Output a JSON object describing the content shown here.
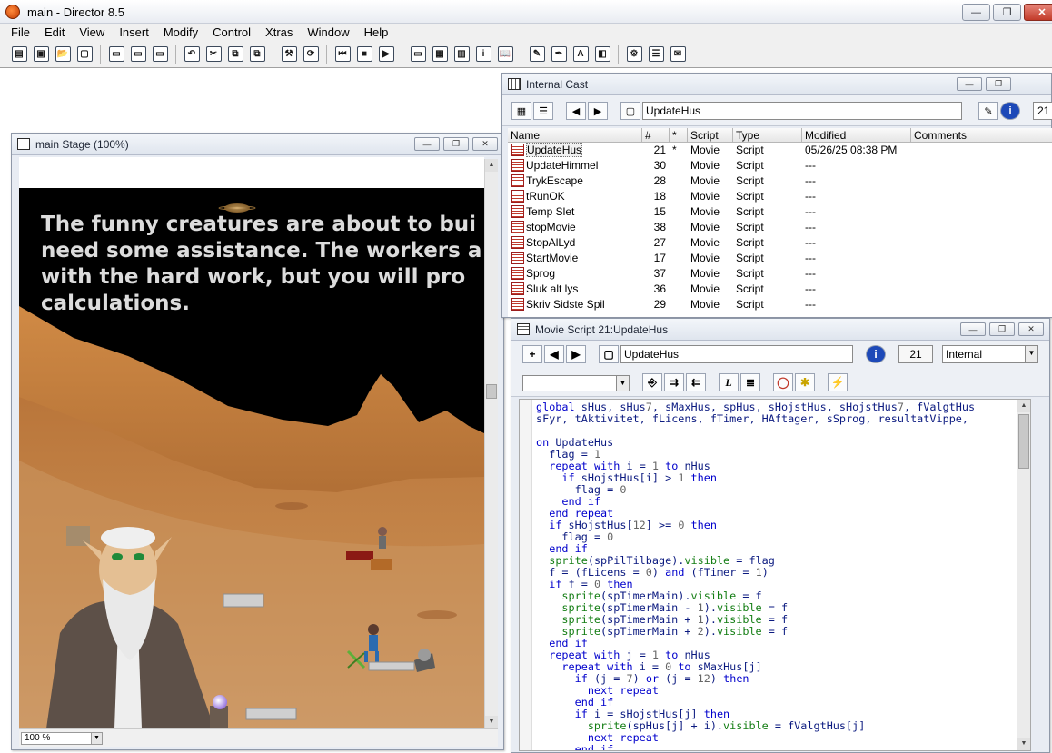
{
  "app": {
    "title": "main - Director 8.5",
    "window_controls": {
      "minimize": "—",
      "maximize": "❐",
      "close": "✕"
    }
  },
  "menu": [
    "File",
    "Edit",
    "View",
    "Insert",
    "Modify",
    "Control",
    "Xtras",
    "Window",
    "Help"
  ],
  "toolbar": {
    "buttons": [
      {
        "icon": "new-movie-icon",
        "glyph": "▤"
      },
      {
        "icon": "new-cast-icon",
        "glyph": "▣"
      },
      {
        "icon": "open-icon",
        "glyph": "📂"
      },
      {
        "icon": "import-icon",
        "glyph": "▢"
      },
      {
        "sep": true
      },
      {
        "icon": "save-icon",
        "glyph": "▭"
      },
      {
        "icon": "save-all-icon",
        "glyph": "▭"
      },
      {
        "icon": "save-shockwave-icon",
        "glyph": "▭"
      },
      {
        "sep": true
      },
      {
        "icon": "undo-icon",
        "glyph": "↶"
      },
      {
        "icon": "cut-icon",
        "glyph": "✂"
      },
      {
        "icon": "copy-icon",
        "glyph": "⧉"
      },
      {
        "icon": "paste-icon",
        "glyph": "⧉"
      },
      {
        "sep": true
      },
      {
        "icon": "find-icon",
        "glyph": "⚒"
      },
      {
        "icon": "exchange-icon",
        "glyph": "⟳"
      },
      {
        "sep": true
      },
      {
        "icon": "rewind-icon",
        "glyph": "⏮"
      },
      {
        "icon": "stop-icon",
        "glyph": "■"
      },
      {
        "icon": "play-icon",
        "glyph": "▶"
      },
      {
        "sep": true
      },
      {
        "icon": "stage-icon",
        "glyph": "▭"
      },
      {
        "icon": "cast-icon",
        "glyph": "▦"
      },
      {
        "icon": "score-icon",
        "glyph": "▥"
      },
      {
        "icon": "property-inspector-icon",
        "glyph": "i"
      },
      {
        "icon": "library-icon",
        "glyph": "📖"
      },
      {
        "sep": true
      },
      {
        "icon": "paint-icon",
        "glyph": "✎"
      },
      {
        "icon": "vector-icon",
        "glyph": "✒"
      },
      {
        "icon": "text-icon",
        "glyph": "A"
      },
      {
        "icon": "shockwave-3d-icon",
        "glyph": "◧"
      },
      {
        "sep": true
      },
      {
        "icon": "behavior-inspector-icon",
        "glyph": "⚙"
      },
      {
        "icon": "script-window-icon",
        "glyph": "☰"
      },
      {
        "icon": "message-window-icon",
        "glyph": "✉"
      }
    ]
  },
  "stage": {
    "title": "main Stage (100%)",
    "text": "The funny creatures are about to bui\nneed some assistance. The workers a\nwith the hard work, but you will pro\ncalculations.",
    "zoom": "100 %"
  },
  "cast": {
    "title": "Internal Cast",
    "selected_name": "UpdateHus",
    "selected_number": "21",
    "columns": [
      "Name",
      "#",
      "*",
      "Script",
      "Type",
      "Modified",
      "Comments"
    ],
    "rows": [
      {
        "name": "UpdateHus",
        "num": "21",
        "star": "*",
        "script": "Movie",
        "type": "Script",
        "modified": "05/26/25 08:38 PM",
        "comments": ""
      },
      {
        "name": "UpdateHimmel",
        "num": "30",
        "star": "",
        "script": "Movie",
        "type": "Script",
        "modified": "---",
        "comments": ""
      },
      {
        "name": "TrykEscape",
        "num": "28",
        "star": "",
        "script": "Movie",
        "type": "Script",
        "modified": "---",
        "comments": ""
      },
      {
        "name": "tRunOK",
        "num": "18",
        "star": "",
        "script": "Movie",
        "type": "Script",
        "modified": "---",
        "comments": ""
      },
      {
        "name": "Temp Slet",
        "num": "15",
        "star": "",
        "script": "Movie",
        "type": "Script",
        "modified": "---",
        "comments": ""
      },
      {
        "name": "stopMovie",
        "num": "38",
        "star": "",
        "script": "Movie",
        "type": "Script",
        "modified": "---",
        "comments": ""
      },
      {
        "name": "StopAlLyd",
        "num": "27",
        "star": "",
        "script": "Movie",
        "type": "Script",
        "modified": "---",
        "comments": ""
      },
      {
        "name": "StartMovie",
        "num": "17",
        "star": "",
        "script": "Movie",
        "type": "Script",
        "modified": "---",
        "comments": ""
      },
      {
        "name": "Sprog",
        "num": "37",
        "star": "",
        "script": "Movie",
        "type": "Script",
        "modified": "---",
        "comments": ""
      },
      {
        "name": "Sluk alt lys",
        "num": "36",
        "star": "",
        "script": "Movie",
        "type": "Script",
        "modified": "---",
        "comments": ""
      },
      {
        "name": "Skriv Sidste Spil",
        "num": "29",
        "star": "",
        "script": "Movie",
        "type": "Script",
        "modified": "---",
        "comments": ""
      }
    ]
  },
  "script_window": {
    "title": "Movie Script 21:UpdateHus",
    "name_field": "UpdateHus",
    "member_number": "21",
    "cast_library": "Internal",
    "handler_select": "",
    "code_lines": [
      "global sHus, sHus7, sMaxHus, spHus, sHojstHus, sHojstHus7, fValgtHus",
      "sFyr, tAktivitet, fLicens, fTimer, HAftager, sSprog, resultatVippe,",
      "",
      "on UpdateHus",
      "  flag = 1",
      "  repeat with i = 1 to nHus",
      "    if sHojstHus[i] > 1 then",
      "      flag = 0",
      "    end if",
      "  end repeat",
      "  if sHojstHus[12] >= 0 then",
      "    flag = 0",
      "  end if",
      "  sprite(spPilTilbage).visible = flag",
      "  f = (fLicens = 0) and (fTimer = 1)",
      "  if f = 0 then",
      "    sprite(spTimerMain).visible = f",
      "    sprite(spTimerMain - 1).visible = f",
      "    sprite(spTimerMain + 1).visible = f",
      "    sprite(spTimerMain + 2).visible = f",
      "  end if",
      "  repeat with j = 1 to nHus",
      "    repeat with i = 0 to sMaxHus[j]",
      "      if (j = 7) or (j = 12) then",
      "        next repeat",
      "      end if",
      "      if i = sHojstHus[j] then",
      "        sprite(spHus[j] + i).visible = fValgtHus[j]",
      "        next repeat",
      "      end if"
    ]
  }
}
